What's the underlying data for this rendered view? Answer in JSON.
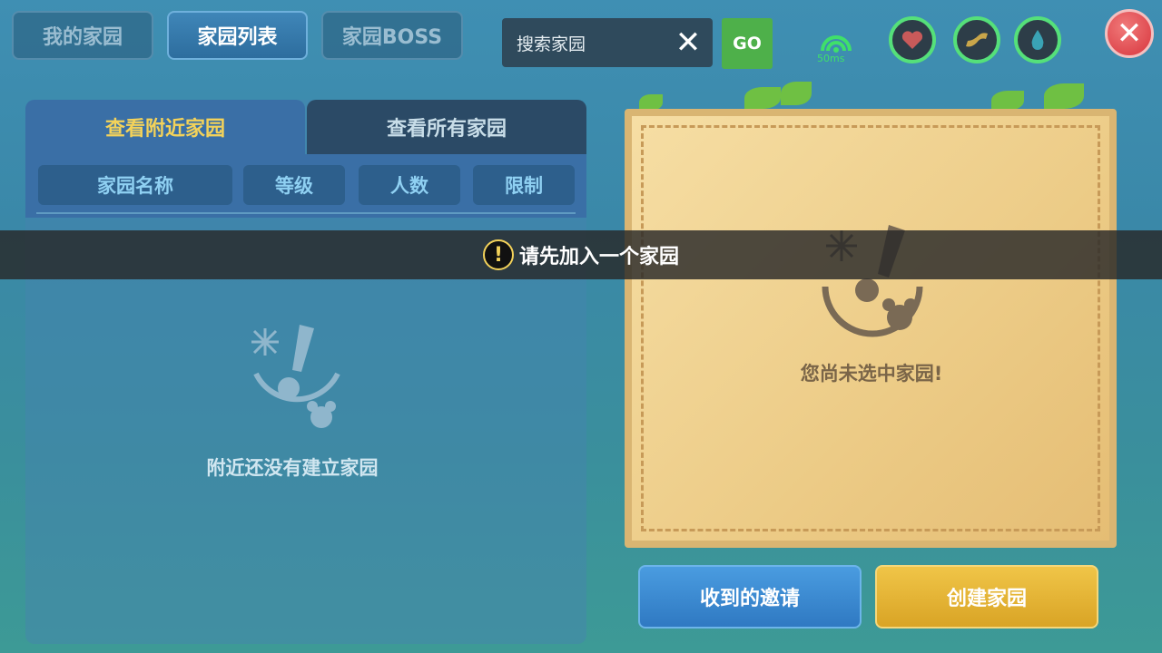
{
  "top_tabs": [
    {
      "label": "我的家园",
      "active": false
    },
    {
      "label": "家园列表",
      "active": true
    },
    {
      "label": "家园BOSS",
      "active": false
    }
  ],
  "search": {
    "placeholder": "搜索家园",
    "go_label": "GO",
    "clear_icon": "close-x-icon"
  },
  "network": {
    "ping": "50ms",
    "icon": "wifi-signal-icon"
  },
  "status_icons": [
    "heart-icon",
    "arm-strength-icon",
    "water-drop-icon"
  ],
  "close_icon": "close-icon",
  "list_tabs": [
    {
      "label": "查看附近家园",
      "active": true
    },
    {
      "label": "查看所有家园",
      "active": false
    }
  ],
  "columns": [
    "家园名称",
    "等级",
    "人数",
    "限制"
  ],
  "empty_list_text": "附近还没有建立家园",
  "toast": {
    "text": "请先加入一个家园",
    "icon": "exclamation-icon"
  },
  "detail": {
    "empty_text": "您尚未选中家园!"
  },
  "buttons": {
    "invitations": "收到的邀请",
    "create": "创建家园"
  },
  "colors": {
    "active_tab_text": "#f3d25a",
    "go_green": "#4eb04a",
    "create_yellow": "#e2b030",
    "invite_blue": "#3a8ad0",
    "stat_ring": "#55e07a"
  }
}
